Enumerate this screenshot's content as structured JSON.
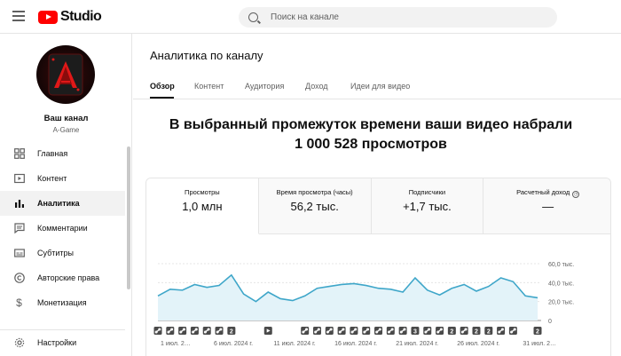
{
  "header": {
    "logo_text": "Studio",
    "search_placeholder": "Поиск на канале"
  },
  "channel": {
    "title": "Ваш канал",
    "handle": "A-Game"
  },
  "sidebar": {
    "items": [
      {
        "label": "Главная",
        "icon": "dashboard-icon"
      },
      {
        "label": "Контент",
        "icon": "content-icon"
      },
      {
        "label": "Аналитика",
        "icon": "analytics-icon",
        "active": true
      },
      {
        "label": "Комментарии",
        "icon": "comments-icon"
      },
      {
        "label": "Субтитры",
        "icon": "subtitles-icon"
      },
      {
        "label": "Авторские права",
        "icon": "copyright-icon"
      },
      {
        "label": "Монетизация",
        "icon": "monetization-icon"
      }
    ],
    "settings_label": "Настройки"
  },
  "main": {
    "title": "Аналитика по каналу",
    "tabs": [
      "Обзор",
      "Контент",
      "Аудитория",
      "Доход",
      "Идеи для видео"
    ],
    "headline_line1": "В выбранный промежуток времени ваши видео набрали",
    "headline_line2": "1 000 528 просмотров"
  },
  "metrics": [
    {
      "label": "Просмотры",
      "value": "1,0 млн"
    },
    {
      "label": "Время просмотра (часы)",
      "value": "56,2 тыс."
    },
    {
      "label": "Подписчики",
      "value": "+1,7 тыс."
    },
    {
      "label": "Расчетный доход",
      "value": "—"
    }
  ],
  "colors": {
    "accent": "#ff0000",
    "line": "#3ea6c9",
    "area": "#e3f3f9"
  },
  "chart_data": {
    "type": "area",
    "ylim": [
      0,
      60000
    ],
    "y_ticks": [
      "60,0 тыс.",
      "40,0 тыс.",
      "20,0 тыс.",
      "0"
    ],
    "x_tick_labels": [
      "1 июл. 2…",
      "6 июл. 2024 г.",
      "11 июл. 2024 г.",
      "16 июл. 2024 г.",
      "21 июл. 2024 г.",
      "26 июл. 2024 г.",
      "31 июл. 2…"
    ],
    "values": [
      26000,
      33000,
      32000,
      38000,
      35000,
      37000,
      48000,
      28000,
      20000,
      30000,
      23000,
      21000,
      26000,
      34000,
      36000,
      38000,
      39000,
      37000,
      34000,
      33000,
      30000,
      45000,
      32000,
      27000,
      34000,
      38000,
      31000,
      36000,
      45000,
      41000,
      26000,
      24000
    ],
    "markers": [
      {
        "index": 0,
        "icon": "link"
      },
      {
        "index": 1,
        "icon": "link"
      },
      {
        "index": 2,
        "icon": "link"
      },
      {
        "index": 3,
        "icon": "link"
      },
      {
        "index": 4,
        "icon": "link"
      },
      {
        "index": 5,
        "icon": "link"
      },
      {
        "index": 6,
        "icon": "2"
      },
      {
        "index": 9,
        "icon": "play"
      },
      {
        "index": 12,
        "icon": "link"
      },
      {
        "index": 13,
        "icon": "link"
      },
      {
        "index": 14,
        "icon": "link"
      },
      {
        "index": 15,
        "icon": "link"
      },
      {
        "index": 16,
        "icon": "link"
      },
      {
        "index": 17,
        "icon": "link"
      },
      {
        "index": 18,
        "icon": "link"
      },
      {
        "index": 19,
        "icon": "link"
      },
      {
        "index": 20,
        "icon": "link"
      },
      {
        "index": 21,
        "icon": "3"
      },
      {
        "index": 22,
        "icon": "link"
      },
      {
        "index": 23,
        "icon": "link"
      },
      {
        "index": 24,
        "icon": "2"
      },
      {
        "index": 25,
        "icon": "link"
      },
      {
        "index": 26,
        "icon": "2"
      },
      {
        "index": 27,
        "icon": "2"
      },
      {
        "index": 28,
        "icon": "link"
      },
      {
        "index": 29,
        "icon": "link"
      },
      {
        "index": 31,
        "icon": "2"
      }
    ]
  }
}
